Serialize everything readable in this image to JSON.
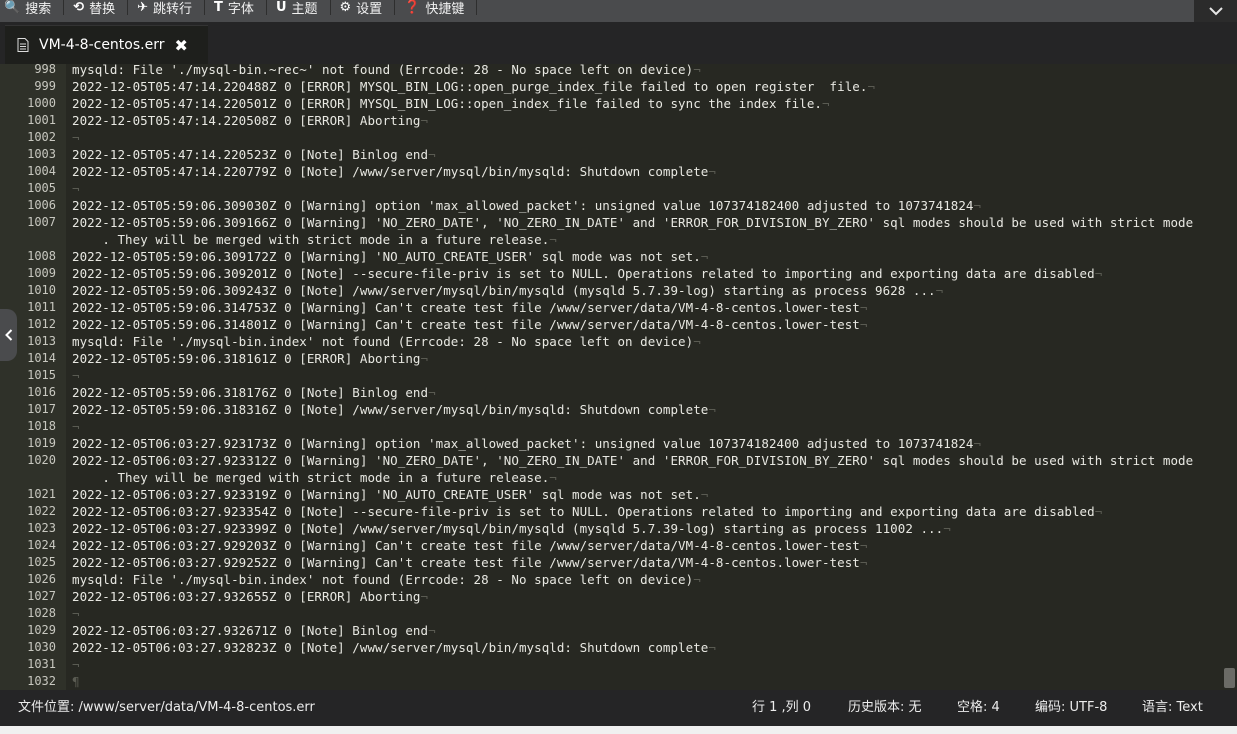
{
  "menu": {
    "items": [
      {
        "icon": "search-icon",
        "glyph": "🔍",
        "label": "搜索"
      },
      {
        "icon": "replace-icon",
        "glyph": "⟲",
        "label": "替换"
      },
      {
        "icon": "jump-icon",
        "glyph": "✈",
        "label": "跳转行"
      },
      {
        "icon": "font-icon",
        "glyph": "T",
        "label": "字体"
      },
      {
        "icon": "theme-icon",
        "glyph": "U",
        "label": "主题"
      },
      {
        "icon": "gear-icon",
        "glyph": "⚙",
        "label": "设置"
      },
      {
        "icon": "help-icon",
        "glyph": "❓",
        "label": "快捷键"
      }
    ]
  },
  "tab": {
    "title": "VM-4-8-centos.err",
    "close_glyph": "✖"
  },
  "editor": {
    "eol_glyph": "¬",
    "eof_glyph": "¶",
    "lines": [
      {
        "n": "998",
        "text": "mysqld: File './mysql-bin.~rec~' not found (Errcode: 28 - No space left on device)"
      },
      {
        "n": "999",
        "text": "2022-12-05T05:47:14.220488Z 0 [ERROR] MYSQL_BIN_LOG::open_purge_index_file failed to open register  file."
      },
      {
        "n": "1000",
        "text": "2022-12-05T05:47:14.220501Z 0 [ERROR] MYSQL_BIN_LOG::open_index_file failed to sync the index file."
      },
      {
        "n": "1001",
        "text": "2022-12-05T05:47:14.220508Z 0 [ERROR] Aborting"
      },
      {
        "n": "1002",
        "text": ""
      },
      {
        "n": "1003",
        "text": "2022-12-05T05:47:14.220523Z 0 [Note] Binlog end"
      },
      {
        "n": "1004",
        "text": "2022-12-05T05:47:14.220779Z 0 [Note] /www/server/mysql/bin/mysqld: Shutdown complete"
      },
      {
        "n": "1005",
        "text": ""
      },
      {
        "n": "1006",
        "text": "2022-12-05T05:59:06.309030Z 0 [Warning] option 'max_allowed_packet': unsigned value 107374182400 adjusted to 1073741824"
      },
      {
        "n": "1007",
        "text": "2022-12-05T05:59:06.309166Z 0 [Warning] 'NO_ZERO_DATE', 'NO_ZERO_IN_DATE' and 'ERROR_FOR_DIVISION_BY_ZERO' sql modes should be used with strict mode",
        "cont": "    . They will be merged with strict mode in a future release."
      },
      {
        "n": "1008",
        "text": "2022-12-05T05:59:06.309172Z 0 [Warning] 'NO_AUTO_CREATE_USER' sql mode was not set."
      },
      {
        "n": "1009",
        "text": "2022-12-05T05:59:06.309201Z 0 [Note] --secure-file-priv is set to NULL. Operations related to importing and exporting data are disabled"
      },
      {
        "n": "1010",
        "text": "2022-12-05T05:59:06.309243Z 0 [Note] /www/server/mysql/bin/mysqld (mysqld 5.7.39-log) starting as process 9628 ..."
      },
      {
        "n": "1011",
        "text": "2022-12-05T05:59:06.314753Z 0 [Warning] Can't create test file /www/server/data/VM-4-8-centos.lower-test"
      },
      {
        "n": "1012",
        "text": "2022-12-05T05:59:06.314801Z 0 [Warning] Can't create test file /www/server/data/VM-4-8-centos.lower-test"
      },
      {
        "n": "1013",
        "text": "mysqld: File './mysql-bin.index' not found (Errcode: 28 - No space left on device)"
      },
      {
        "n": "1014",
        "text": "2022-12-05T05:59:06.318161Z 0 [ERROR] Aborting"
      },
      {
        "n": "1015",
        "text": ""
      },
      {
        "n": "1016",
        "text": "2022-12-05T05:59:06.318176Z 0 [Note] Binlog end"
      },
      {
        "n": "1017",
        "text": "2022-12-05T05:59:06.318316Z 0 [Note] /www/server/mysql/bin/mysqld: Shutdown complete"
      },
      {
        "n": "1018",
        "text": ""
      },
      {
        "n": "1019",
        "text": "2022-12-05T06:03:27.923173Z 0 [Warning] option 'max_allowed_packet': unsigned value 107374182400 adjusted to 1073741824"
      },
      {
        "n": "1020",
        "text": "2022-12-05T06:03:27.923312Z 0 [Warning] 'NO_ZERO_DATE', 'NO_ZERO_IN_DATE' and 'ERROR_FOR_DIVISION_BY_ZERO' sql modes should be used with strict mode",
        "cont": "    . They will be merged with strict mode in a future release."
      },
      {
        "n": "1021",
        "text": "2022-12-05T06:03:27.923319Z 0 [Warning] 'NO_AUTO_CREATE_USER' sql mode was not set."
      },
      {
        "n": "1022",
        "text": "2022-12-05T06:03:27.923354Z 0 [Note] --secure-file-priv is set to NULL. Operations related to importing and exporting data are disabled"
      },
      {
        "n": "1023",
        "text": "2022-12-05T06:03:27.923399Z 0 [Note] /www/server/mysql/bin/mysqld (mysqld 5.7.39-log) starting as process 11002 ..."
      },
      {
        "n": "1024",
        "text": "2022-12-05T06:03:27.929203Z 0 [Warning] Can't create test file /www/server/data/VM-4-8-centos.lower-test"
      },
      {
        "n": "1025",
        "text": "2022-12-05T06:03:27.929252Z 0 [Warning] Can't create test file /www/server/data/VM-4-8-centos.lower-test"
      },
      {
        "n": "1026",
        "text": "mysqld: File './mysql-bin.index' not found (Errcode: 28 - No space left on device)"
      },
      {
        "n": "1027",
        "text": "2022-12-05T06:03:27.932655Z 0 [ERROR] Aborting"
      },
      {
        "n": "1028",
        "text": ""
      },
      {
        "n": "1029",
        "text": "2022-12-05T06:03:27.932671Z 0 [Note] Binlog end"
      },
      {
        "n": "1030",
        "text": "2022-12-05T06:03:27.932823Z 0 [Note] /www/server/mysql/bin/mysqld: Shutdown complete"
      },
      {
        "n": "1031",
        "text": ""
      },
      {
        "n": "1032",
        "text": "",
        "eof": true
      }
    ]
  },
  "status": {
    "path": "文件位置: /www/server/data/VM-4-8-centos.err",
    "position": "行 1 ,列 0",
    "history": "历史版本: 无",
    "spaces": "空格: 4",
    "encoding": "编码: UTF-8",
    "language": "语言: Text"
  },
  "colors": {
    "editor_bg": "#272822",
    "gutter_bg": "#2f3129",
    "menu_bg": "#4a4b4d",
    "status_bg": "#252526"
  }
}
